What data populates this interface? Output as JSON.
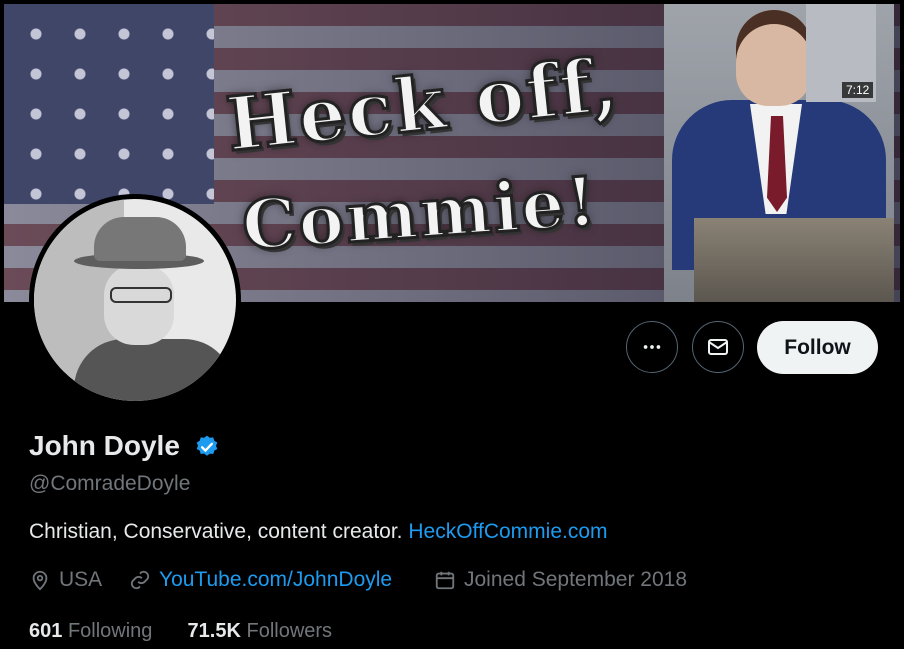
{
  "banner": {
    "title_line1": "Heck off,",
    "title_line2": "Commie!",
    "video_duration": "7:12"
  },
  "profile": {
    "name": "John Doyle",
    "handle": "@ComradeDoyle",
    "bio_text": "Christian, Conservative, content creator.",
    "bio_link": "HeckOffCommie.com",
    "location": "USA",
    "website": "YouTube.com/JohnDoyle",
    "joined": "Joined September 2018",
    "following_count": "601",
    "following_label": "Following",
    "followers_count": "71.5K",
    "followers_label": "Followers"
  },
  "actions": {
    "more_icon": "ellipsis-icon",
    "message_icon": "envelope-icon",
    "follow_label": "Follow"
  },
  "colors": {
    "background": "#000000",
    "link": "#1d9bf0",
    "secondary_text": "#71767b",
    "follow_button_bg": "#eff3f4",
    "verified_badge": "#1d9bf0"
  }
}
